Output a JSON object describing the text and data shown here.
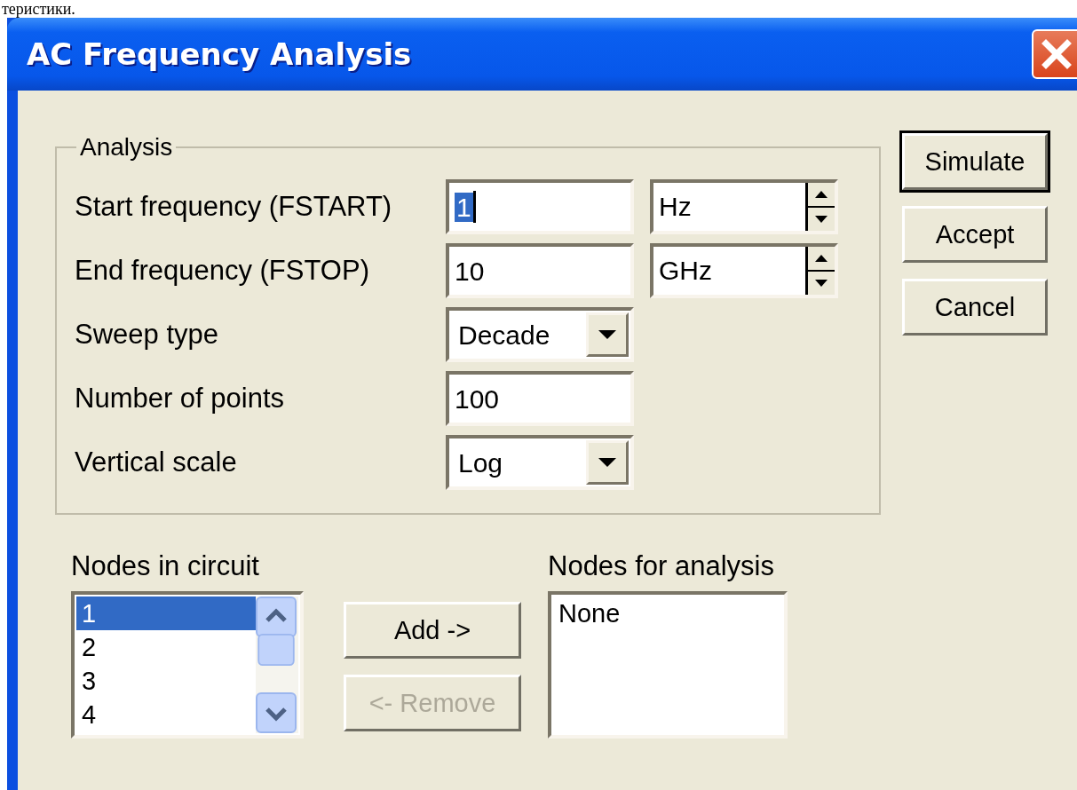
{
  "page_text": "теристики.",
  "window": {
    "title": "AC Frequency Analysis"
  },
  "analysis": {
    "title": "Analysis",
    "rows": [
      {
        "kind": "text_unit",
        "label": "Start frequency (FSTART)",
        "value": "1",
        "text_selected": true,
        "unit": "Hz"
      },
      {
        "kind": "text_unit",
        "label": "End frequency (FSTOP)",
        "value": "10",
        "text_selected": false,
        "unit": "GHz"
      },
      {
        "kind": "dropdown",
        "label": "Sweep type",
        "value": "Decade"
      },
      {
        "kind": "text",
        "label": "Number of points",
        "value": "100"
      },
      {
        "kind": "dropdown",
        "label": "Vertical scale",
        "value": "Log"
      }
    ]
  },
  "side_buttons": [
    {
      "label": "Simulate",
      "default": true
    },
    {
      "label": "Accept",
      "default": false
    },
    {
      "label": "Cancel",
      "default": false
    }
  ],
  "nodes_in_circuit": {
    "label": "Nodes in circuit",
    "items": [
      {
        "label": "1",
        "selected": true
      },
      {
        "label": "2",
        "selected": false
      },
      {
        "label": "3",
        "selected": false
      },
      {
        "label": "4",
        "selected": false
      }
    ]
  },
  "move_buttons": [
    {
      "label": "Add ->",
      "disabled": false
    },
    {
      "label": "<- Remove",
      "disabled": true
    }
  ],
  "nodes_for_analysis": {
    "label": "Nodes for analysis",
    "items": [
      {
        "label": "None"
      }
    ]
  }
}
